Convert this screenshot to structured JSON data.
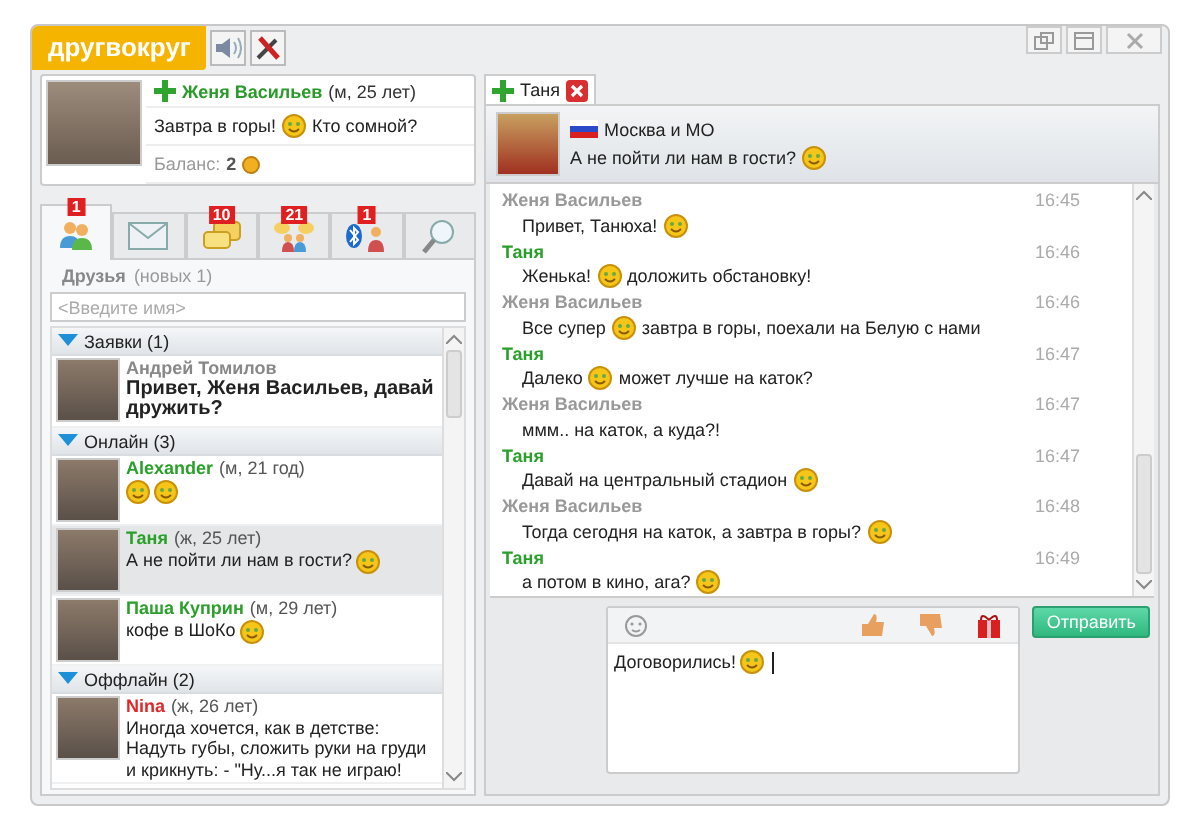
{
  "app": {
    "logo": "другвокруг"
  },
  "profile": {
    "name": "Женя Васильев",
    "info": "(м, 25 лет)",
    "status": [
      {
        "kind": "text",
        "text": "Завтра в горы!"
      },
      {
        "kind": "smiley"
      },
      {
        "kind": "text",
        "text": "Кто сомной?"
      }
    ],
    "balance_label": "Баланс:",
    "balance": "2"
  },
  "tabs": [
    {
      "badge": "1",
      "selected": true
    },
    {
      "selected": false
    },
    {
      "badge": "10",
      "selected": false
    },
    {
      "badge": "21",
      "selected": false
    },
    {
      "badge": "1",
      "selected": false
    },
    {
      "selected": false
    }
  ],
  "friends": {
    "title": "Друзья",
    "subtitle": "(новых 1)",
    "search": {
      "placeholder": "<Введите имя>"
    }
  },
  "groups": [
    {
      "title": "Заявки (1)",
      "contacts": [
        {
          "kind": "request",
          "color": "#888888",
          "name": "Андрей Томилов",
          "selected": false,
          "message": [
            {
              "kind": "text",
              "text": "Привет, Женя Васильев, давай дружить?"
            }
          ]
        }
      ]
    },
    {
      "title": "Онлайн (3)",
      "contacts": [
        {
          "kind": "friend",
          "color": "#2aa02a",
          "name": "Alexander",
          "info": "(м, 21 год)",
          "selected": false,
          "message": [
            {
              "kind": "smiley"
            },
            {
              "kind": "smiley"
            }
          ]
        },
        {
          "kind": "friend",
          "color": "#2aa02a",
          "name": "Таня",
          "info": "(ж, 25 лет)",
          "selected": true,
          "message": [
            {
              "kind": "text",
              "text": "А не пойти ли нам в гости?"
            },
            {
              "kind": "smiley"
            }
          ]
        },
        {
          "kind": "friend",
          "color": "#2aa02a",
          "name": "Паша Куприн",
          "info": "(м, 29 лет)",
          "selected": false,
          "message": [
            {
              "kind": "text",
              "text": "кофе в ШоКо"
            },
            {
              "kind": "smiley"
            }
          ]
        }
      ]
    },
    {
      "title": "Оффлайн (2)",
      "contacts": [
        {
          "kind": "friend",
          "color": "#e02828",
          "name": "Nina",
          "info": "(ж, 26 лет)",
          "selected": false,
          "message": [
            {
              "kind": "text",
              "text": "Иногда хочется, как в детстве: Надуть губы, сложить руки на груди и крикнуть: - \"Ну...я так не играю!"
            }
          ]
        }
      ]
    }
  ],
  "chat": {
    "tab": {
      "name": "Таня",
      "selected": true
    },
    "header": {
      "location": "Москва и МО",
      "status": [
        {
          "kind": "text",
          "text": "А не пойти ли нам в гости?"
        },
        {
          "kind": "smiley"
        }
      ]
    },
    "messages": [
      {
        "author": "Женя Васильев",
        "self": true,
        "time": "16:45",
        "parts": [
          {
            "kind": "text",
            "text": "Привет, Танюха!"
          },
          {
            "kind": "smiley"
          }
        ]
      },
      {
        "author": "Таня",
        "self": false,
        "time": "16:46",
        "parts": [
          {
            "kind": "text",
            "text": "Женька!"
          },
          {
            "kind": "smiley"
          },
          {
            "kind": "text",
            "text": "доложить обстановку!"
          }
        ]
      },
      {
        "author": "Женя Васильев",
        "self": true,
        "time": "16:46",
        "parts": [
          {
            "kind": "text",
            "text": "Все супер"
          },
          {
            "kind": "smiley"
          },
          {
            "kind": "text",
            "text": "завтра в горы, поехали на Белую с нами"
          }
        ]
      },
      {
        "author": "Таня",
        "self": false,
        "time": "16:47",
        "parts": [
          {
            "kind": "text",
            "text": "Далеко"
          },
          {
            "kind": "smiley"
          },
          {
            "kind": "text",
            "text": "может лучше на каток?"
          }
        ]
      },
      {
        "author": "Женя Васильев",
        "self": true,
        "time": "16:47",
        "parts": [
          {
            "kind": "text",
            "text": "ммм.. на каток, а куда?!"
          }
        ]
      },
      {
        "author": "Таня",
        "self": false,
        "time": "16:47",
        "parts": [
          {
            "kind": "text",
            "text": "Давай на центральный стадион"
          },
          {
            "kind": "smiley"
          }
        ]
      },
      {
        "author": "Женя Васильев",
        "self": true,
        "time": "16:48",
        "parts": [
          {
            "kind": "text",
            "text": "Тогда сегодня на каток, а завтра в горы?"
          },
          {
            "kind": "smiley"
          }
        ]
      },
      {
        "author": "Таня",
        "self": false,
        "time": "16:49",
        "parts": [
          {
            "kind": "text",
            "text": "а потом в кино, ага?"
          },
          {
            "kind": "smiley"
          }
        ]
      }
    ],
    "composer": {
      "parts": [
        {
          "kind": "text",
          "text": "Договорились!"
        },
        {
          "kind": "smiley"
        }
      ]
    },
    "send_button": "Отправить"
  }
}
